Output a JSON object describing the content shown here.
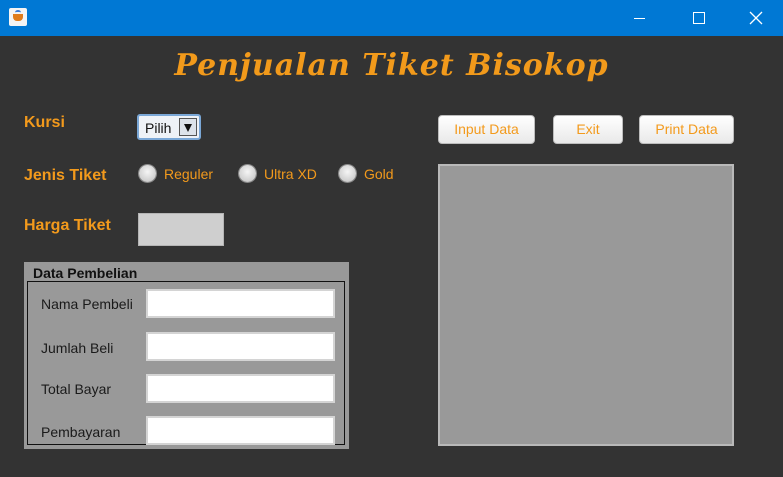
{
  "window": {
    "minimize_icon": "minimize-icon",
    "maximize_icon": "maximize-icon",
    "close_icon": "close-icon",
    "app_icon": "java-cup-icon"
  },
  "heading": "Penjualan Tiket Bisokop",
  "form": {
    "kursi_label": "Kursi",
    "kursi_selected": "Pilih",
    "jenis_tiket_label": "Jenis Tiket",
    "radio_options": [
      "Reguler",
      "Ultra XD",
      "Gold"
    ],
    "harga_tiket_label": "Harga Tiket",
    "harga_tiket_value": ""
  },
  "buttons": {
    "input_data": "Input Data",
    "exit": "Exit",
    "print_data": "Print Data"
  },
  "panel": {
    "title": "Data Pembelian",
    "fields": [
      {
        "label": "Nama Pembeli",
        "value": ""
      },
      {
        "label": "Jumlah Beli",
        "value": ""
      },
      {
        "label": "Total Bayar",
        "value": ""
      },
      {
        "label": "Pembayaran",
        "value": ""
      }
    ]
  },
  "output": {
    "text": ""
  },
  "colors": {
    "titlebar": "#0078d4",
    "background": "#333333",
    "accent": "#f39a1c",
    "panel": "#999999"
  }
}
